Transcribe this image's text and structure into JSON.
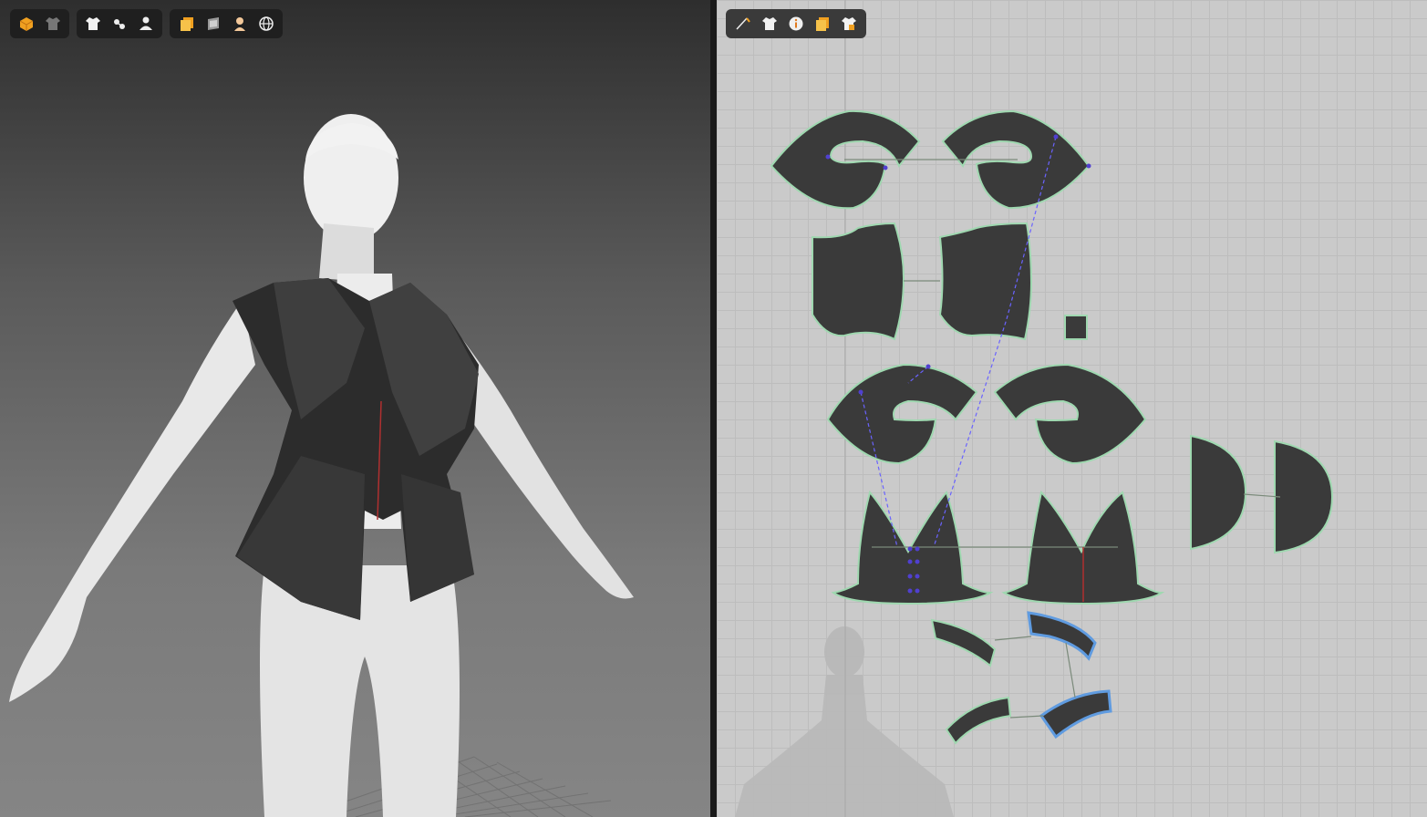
{
  "viewport_3d": {
    "toolbar_groups": [
      {
        "icons": [
          "avatar-box-icon",
          "garment-dark-icon"
        ]
      },
      {
        "icons": [
          "shirt-icon",
          "fitting-tools-icon",
          "avatar-person-icon"
        ]
      },
      {
        "icons": [
          "texture-icon",
          "fabric-layer-icon",
          "skin-icon",
          "globe-icon"
        ]
      }
    ]
  },
  "viewport_2d": {
    "toolbar_icons": [
      "pen-pattern-icon",
      "shirt-icon",
      "info-icon",
      "texture-icon",
      "lock-shirt-icon"
    ]
  },
  "colors": {
    "toolbar_bg": "#1f1f1f",
    "pattern_fill": "#3a3a3a",
    "pattern_outline": "#9fd8b0",
    "selected_outline": "#5f9be0",
    "seam_line": "#6a63ff",
    "canvas_bg": "#cacaca"
  }
}
